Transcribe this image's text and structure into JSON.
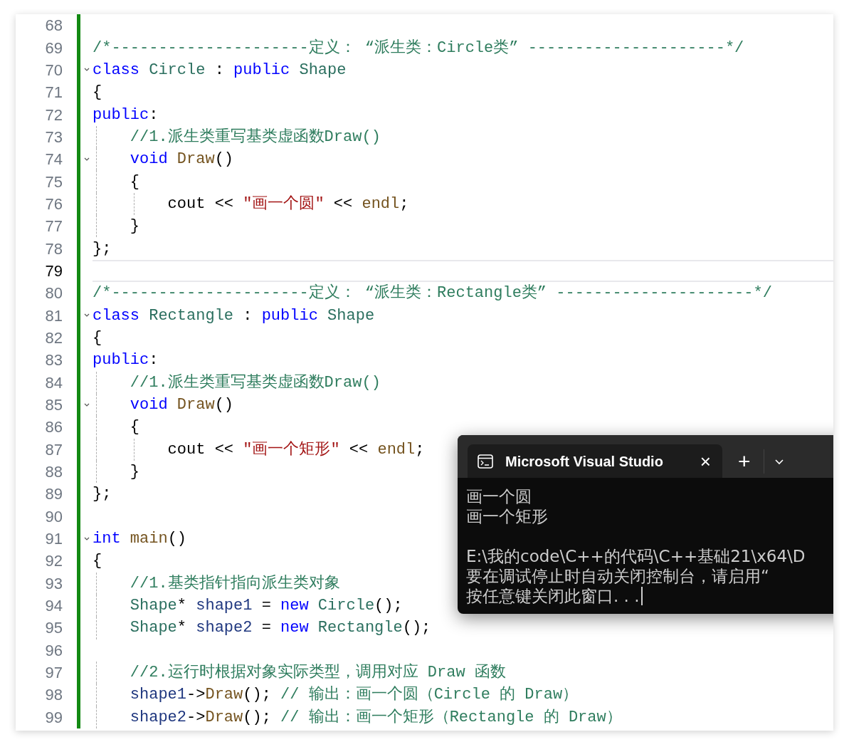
{
  "editor": {
    "lines": [
      {
        "number": "68",
        "fold": false,
        "current": false
      },
      {
        "number": "69",
        "fold": false,
        "current": false,
        "tokens": [
          {
            "kind": "comment",
            "text": "/*---------------------定义： “派生类：Circle类” ---------------------*/"
          }
        ]
      },
      {
        "number": "70",
        "fold": true,
        "current": false,
        "tokens": [
          {
            "kind": "keyword",
            "text": "class"
          },
          {
            "kind": "type",
            "text": " Circle"
          },
          {
            "kind": "plain",
            "text": " : "
          },
          {
            "kind": "keyword",
            "text": "public"
          },
          {
            "kind": "type",
            "text": " Shape"
          }
        ]
      },
      {
        "number": "71",
        "fold": false,
        "current": false,
        "tokens": [
          {
            "kind": "plain",
            "text": "{"
          }
        ]
      },
      {
        "number": "72",
        "fold": false,
        "current": false,
        "tokens": [
          {
            "kind": "keyword",
            "text": "public"
          },
          {
            "kind": "plain",
            "text": ":"
          }
        ]
      },
      {
        "number": "73",
        "fold": false,
        "current": false,
        "tokens": [
          {
            "kind": "comment",
            "text": "    //1.派生类重写基类虚函数Draw()"
          }
        ]
      },
      {
        "number": "74",
        "fold": true,
        "current": false,
        "tokens": [
          {
            "kind": "keyword",
            "text": "    void"
          },
          {
            "kind": "function",
            "text": " Draw"
          },
          {
            "kind": "plain",
            "text": "()"
          }
        ]
      },
      {
        "number": "75",
        "fold": false,
        "current": false,
        "tokens": [
          {
            "kind": "plain",
            "text": "    {"
          }
        ]
      },
      {
        "number": "76",
        "fold": false,
        "current": false,
        "tokens": [
          {
            "kind": "plain",
            "text": "        cout << "
          },
          {
            "kind": "string",
            "text": "\"画一个圆\""
          },
          {
            "kind": "plain",
            "text": " << "
          },
          {
            "kind": "function",
            "text": "endl"
          },
          {
            "kind": "plain",
            "text": ";"
          }
        ]
      },
      {
        "number": "77",
        "fold": false,
        "current": false,
        "tokens": [
          {
            "kind": "plain",
            "text": "    }"
          }
        ]
      },
      {
        "number": "78",
        "fold": false,
        "current": false,
        "tokens": [
          {
            "kind": "plain",
            "text": "};"
          }
        ]
      },
      {
        "number": "79",
        "fold": false,
        "current": true
      },
      {
        "number": "80",
        "fold": false,
        "current": false,
        "tokens": [
          {
            "kind": "comment",
            "text": "/*---------------------定义： “派生类：Rectangle类” ---------------------*/"
          }
        ]
      },
      {
        "number": "81",
        "fold": true,
        "current": false,
        "tokens": [
          {
            "kind": "keyword",
            "text": "class"
          },
          {
            "kind": "type",
            "text": " Rectangle"
          },
          {
            "kind": "plain",
            "text": " : "
          },
          {
            "kind": "keyword",
            "text": "public"
          },
          {
            "kind": "type",
            "text": " Shape"
          }
        ]
      },
      {
        "number": "82",
        "fold": false,
        "current": false,
        "tokens": [
          {
            "kind": "plain",
            "text": "{"
          }
        ]
      },
      {
        "number": "83",
        "fold": false,
        "current": false,
        "tokens": [
          {
            "kind": "keyword",
            "text": "public"
          },
          {
            "kind": "plain",
            "text": ":"
          }
        ]
      },
      {
        "number": "84",
        "fold": false,
        "current": false,
        "tokens": [
          {
            "kind": "comment",
            "text": "    //1.派生类重写基类虚函数Draw()"
          }
        ]
      },
      {
        "number": "85",
        "fold": true,
        "current": false,
        "tokens": [
          {
            "kind": "keyword",
            "text": "    void"
          },
          {
            "kind": "function",
            "text": " Draw"
          },
          {
            "kind": "plain",
            "text": "()"
          }
        ]
      },
      {
        "number": "86",
        "fold": false,
        "current": false,
        "tokens": [
          {
            "kind": "plain",
            "text": "    {"
          }
        ]
      },
      {
        "number": "87",
        "fold": false,
        "current": false,
        "tokens": [
          {
            "kind": "plain",
            "text": "        cout << "
          },
          {
            "kind": "string",
            "text": "\"画一个矩形\""
          },
          {
            "kind": "plain",
            "text": " << "
          },
          {
            "kind": "function",
            "text": "endl"
          },
          {
            "kind": "plain",
            "text": ";"
          }
        ]
      },
      {
        "number": "88",
        "fold": false,
        "current": false,
        "tokens": [
          {
            "kind": "plain",
            "text": "    }"
          }
        ]
      },
      {
        "number": "89",
        "fold": false,
        "current": false,
        "tokens": [
          {
            "kind": "plain",
            "text": "};"
          }
        ]
      },
      {
        "number": "90",
        "fold": false,
        "current": false
      },
      {
        "number": "91",
        "fold": true,
        "current": false,
        "tokens": [
          {
            "kind": "keyword",
            "text": "int"
          },
          {
            "kind": "function",
            "text": " main"
          },
          {
            "kind": "plain",
            "text": "()"
          }
        ]
      },
      {
        "number": "92",
        "fold": false,
        "current": false,
        "tokens": [
          {
            "kind": "plain",
            "text": "{"
          }
        ]
      },
      {
        "number": "93",
        "fold": false,
        "current": false,
        "tokens": [
          {
            "kind": "comment",
            "text": "    //1.基类指针指向派生类对象"
          }
        ]
      },
      {
        "number": "94",
        "fold": false,
        "current": false,
        "tokens": [
          {
            "kind": "type",
            "text": "    Shape"
          },
          {
            "kind": "plain",
            "text": "* "
          },
          {
            "kind": "variable",
            "text": "shape1"
          },
          {
            "kind": "plain",
            "text": " = "
          },
          {
            "kind": "keyword",
            "text": "new"
          },
          {
            "kind": "type",
            "text": " Circle"
          },
          {
            "kind": "plain",
            "text": "();"
          }
        ]
      },
      {
        "number": "95",
        "fold": false,
        "current": false,
        "tokens": [
          {
            "kind": "type",
            "text": "    Shape"
          },
          {
            "kind": "plain",
            "text": "* "
          },
          {
            "kind": "variable",
            "text": "shape2"
          },
          {
            "kind": "plain",
            "text": " = "
          },
          {
            "kind": "keyword",
            "text": "new"
          },
          {
            "kind": "type",
            "text": " Rectangle"
          },
          {
            "kind": "plain",
            "text": "();"
          }
        ]
      },
      {
        "number": "96",
        "fold": false,
        "current": false
      },
      {
        "number": "97",
        "fold": false,
        "current": false,
        "tokens": [
          {
            "kind": "comment",
            "text": "    //2.运行时根据对象实际类型，调用对应 Draw 函数"
          }
        ]
      },
      {
        "number": "98",
        "fold": false,
        "current": false,
        "tokens": [
          {
            "kind": "variable",
            "text": "    shape1"
          },
          {
            "kind": "plain",
            "text": "->"
          },
          {
            "kind": "function",
            "text": "Draw"
          },
          {
            "kind": "plain",
            "text": "();"
          },
          {
            "kind": "comment",
            "text": " // 输出：画一个圆（Circle 的 Draw）"
          }
        ]
      },
      {
        "number": "99",
        "fold": false,
        "current": false,
        "tokens": [
          {
            "kind": "variable",
            "text": "    shape2"
          },
          {
            "kind": "plain",
            "text": "->"
          },
          {
            "kind": "function",
            "text": "Draw"
          },
          {
            "kind": "plain",
            "text": "();"
          },
          {
            "kind": "comment",
            "text": " // 输出：画一个矩形（Rectangle 的 Draw）"
          }
        ]
      }
    ]
  },
  "console": {
    "tab_title": "Microsoft Visual Studio",
    "close": "×",
    "new_tab": "+",
    "blocks": [
      [
        "画一个圆",
        "画一个矩形"
      ],
      [
        "E:\\我的code\\C++的代码\\C++基础21\\x64\\D",
        "要在调试停止时自动关闭控制台，请启用“",
        "按任意键关闭此窗口. . ."
      ]
    ]
  }
}
